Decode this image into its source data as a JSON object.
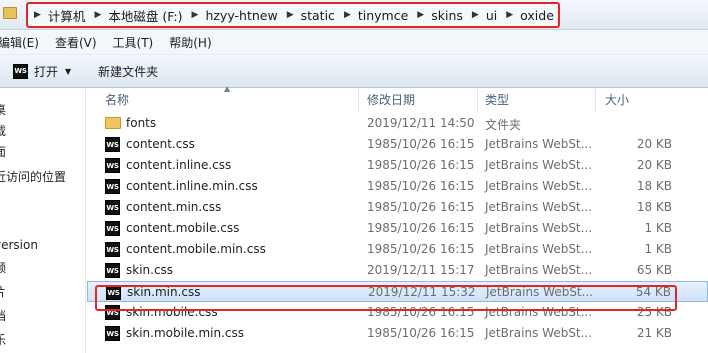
{
  "address_bar": {
    "crumbs": [
      "计算机",
      "本地磁盘 (F:)",
      "hzyy-htnew",
      "static",
      "tinymce",
      "skins",
      "ui",
      "oxide"
    ]
  },
  "menu": {
    "items": [
      "编辑(E)",
      "查看(V)",
      "工具(T)",
      "帮助(H)"
    ]
  },
  "toolbar": {
    "open_label": "打开",
    "new_folder_label": "新建文件夹"
  },
  "nav": {
    "items": [
      "桌",
      "载",
      "面",
      "近访问的位置",
      "version",
      "频",
      "片",
      "档",
      "乐"
    ]
  },
  "columns": {
    "name": "名称",
    "date": "修改日期",
    "type": "类型",
    "size": "大小"
  },
  "files": [
    {
      "name": "fonts",
      "date": "2019/12/11 14:50",
      "type": "文件夹",
      "size": "",
      "icon": "folder-icon"
    },
    {
      "name": "content.css",
      "date": "1985/10/26 16:15",
      "type": "JetBrains WebSt...",
      "size": "20 KB",
      "icon": "webstorm-icon"
    },
    {
      "name": "content.inline.css",
      "date": "1985/10/26 16:15",
      "type": "JetBrains WebSt...",
      "size": "20 KB",
      "icon": "webstorm-icon"
    },
    {
      "name": "content.inline.min.css",
      "date": "1985/10/26 16:15",
      "type": "JetBrains WebSt...",
      "size": "18 KB",
      "icon": "webstorm-icon"
    },
    {
      "name": "content.min.css",
      "date": "1985/10/26 16:15",
      "type": "JetBrains WebSt...",
      "size": "18 KB",
      "icon": "webstorm-icon"
    },
    {
      "name": "content.mobile.css",
      "date": "1985/10/26 16:15",
      "type": "JetBrains WebSt...",
      "size": "1 KB",
      "icon": "webstorm-icon"
    },
    {
      "name": "content.mobile.min.css",
      "date": "1985/10/26 16:15",
      "type": "JetBrains WebSt...",
      "size": "1 KB",
      "icon": "webstorm-icon"
    },
    {
      "name": "skin.css",
      "date": "2019/12/11 15:17",
      "type": "JetBrains WebSt...",
      "size": "65 KB",
      "icon": "webstorm-icon"
    },
    {
      "name": "skin.min.css",
      "date": "2019/12/11 15:32",
      "type": "JetBrains WebSt...",
      "size": "54 KB",
      "icon": "webstorm-icon"
    },
    {
      "name": "skin.mobile.css",
      "date": "1985/10/26 16:15",
      "type": "JetBrains WebSt...",
      "size": "25 KB",
      "icon": "webstorm-icon"
    },
    {
      "name": "skin.mobile.min.css",
      "date": "1985/10/26 16:15",
      "type": "JetBrains WebSt...",
      "size": "21 KB",
      "icon": "webstorm-icon"
    }
  ],
  "icon_text": "WS",
  "selected_file": "skin.min.css",
  "colors": {
    "highlight_red": "#e0262a",
    "selection_blue": "#cfe3f8"
  }
}
